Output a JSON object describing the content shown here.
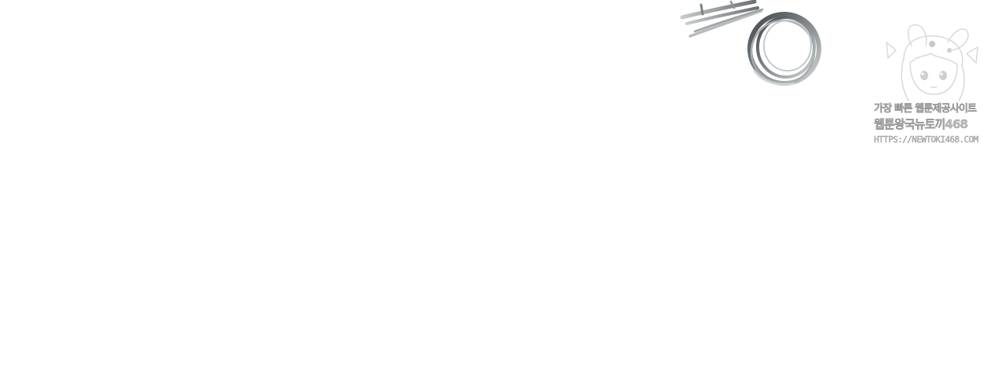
{
  "canvas": {
    "background": "#ffffff"
  },
  "artwork": {
    "stroke_color": "#5a6063",
    "stroke_highlight": "#c9cccd"
  },
  "watermark": {
    "line1": "가장 빠른 웹툰제공사이트",
    "line2": "웹툰왕국뉴토끼468",
    "line3": "HTTPS://NEWTOKI468.COM",
    "color": "#b9b9b9",
    "mascot_icon": "bunny-mascot-icon"
  }
}
